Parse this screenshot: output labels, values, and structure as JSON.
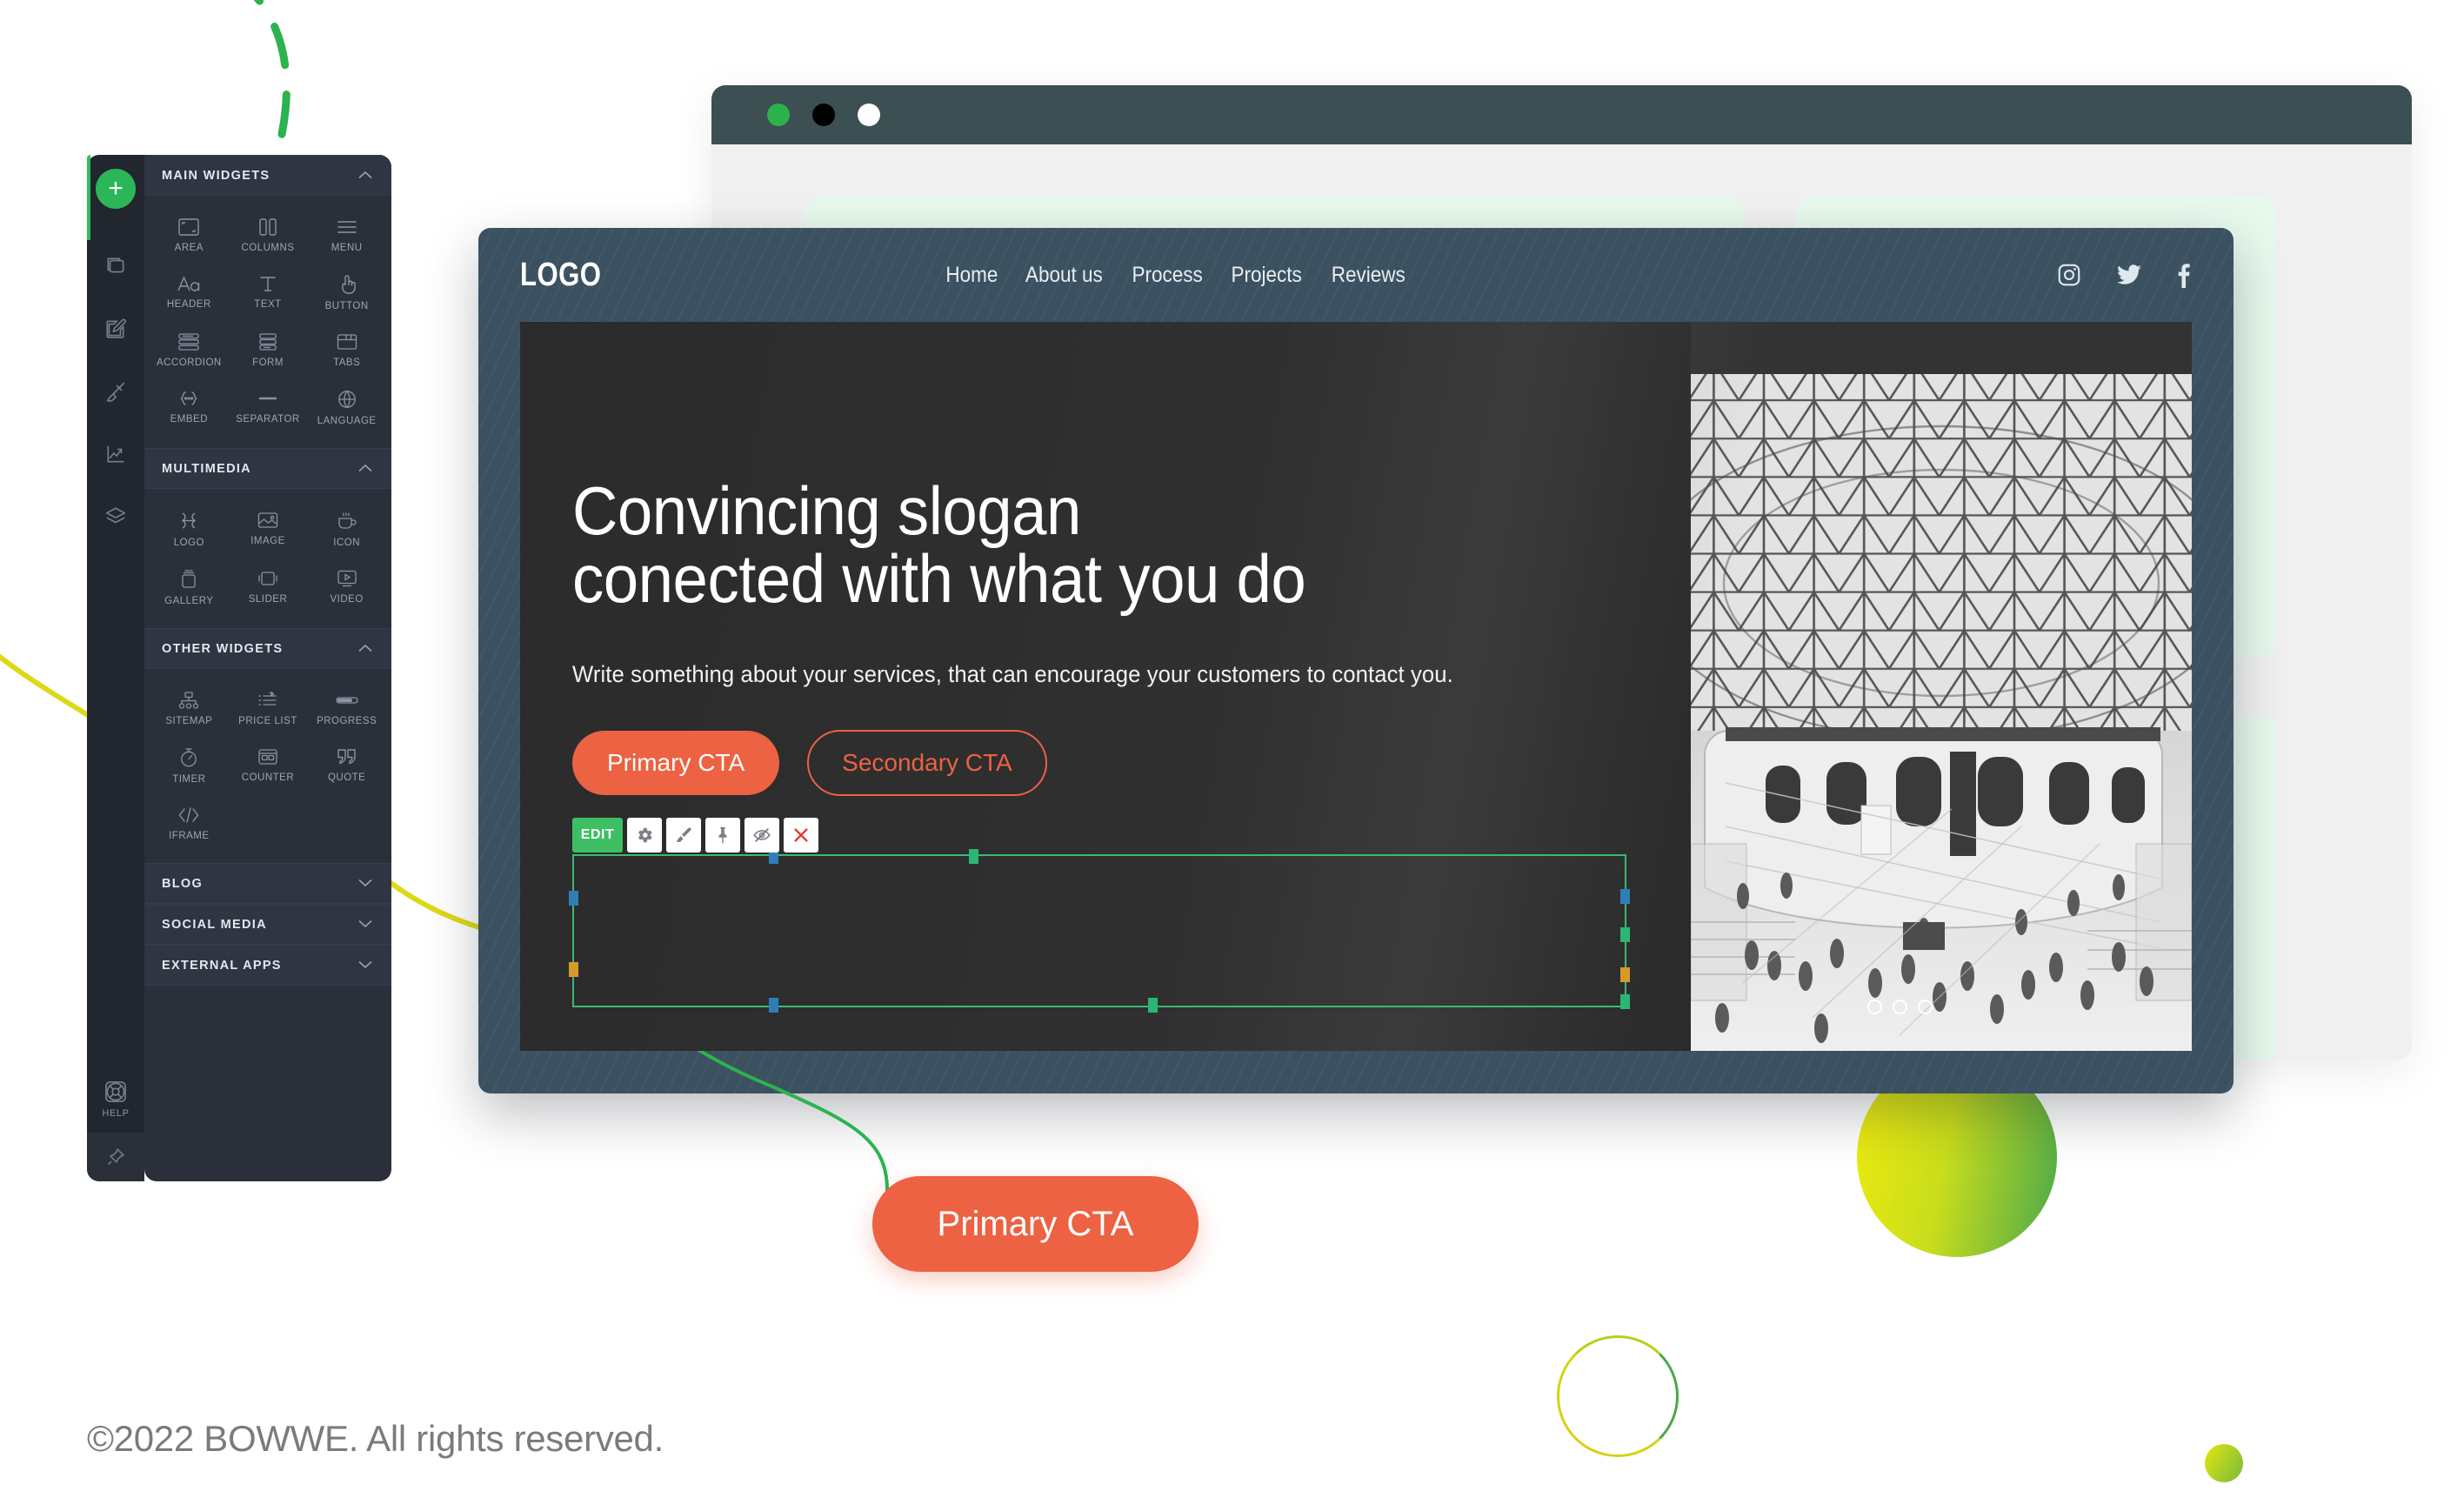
{
  "footer": {
    "copyright": "©2022 BOWWE. All rights reserved."
  },
  "rail": {
    "add_label": "+",
    "icons": [
      {
        "name": "pages-icon"
      },
      {
        "name": "edit-icon"
      },
      {
        "name": "brush-icon"
      },
      {
        "name": "analytics-icon"
      },
      {
        "name": "layers-icon"
      }
    ],
    "help_label": "HELP",
    "pin_label": "pin-icon"
  },
  "widget_panel": {
    "groups": [
      {
        "title": "MAIN WIDGETS",
        "expanded": true,
        "chevron": "chevron-up",
        "items": [
          {
            "label": "AREA",
            "icon": "area-icon"
          },
          {
            "label": "COLUMNS",
            "icon": "columns-icon"
          },
          {
            "label": "MENU",
            "icon": "menu-icon"
          },
          {
            "label": "HEADER",
            "icon": "header-icon"
          },
          {
            "label": "TEXT",
            "icon": "text-icon"
          },
          {
            "label": "BUTTON",
            "icon": "button-icon"
          },
          {
            "label": "ACCORDION",
            "icon": "accordion-icon"
          },
          {
            "label": "FORM",
            "icon": "form-icon"
          },
          {
            "label": "TABS",
            "icon": "tabs-icon"
          },
          {
            "label": "EMBED",
            "icon": "embed-icon"
          },
          {
            "label": "SEPARATOR",
            "icon": "separator-icon"
          },
          {
            "label": "LANGUAGE",
            "icon": "language-icon"
          }
        ]
      },
      {
        "title": "MULTIMEDIA",
        "expanded": true,
        "chevron": "chevron-up",
        "items": [
          {
            "label": "LOGO",
            "icon": "logo-icon"
          },
          {
            "label": "IMAGE",
            "icon": "image-icon"
          },
          {
            "label": "ICON",
            "icon": "cup-icon"
          },
          {
            "label": "GALLERY",
            "icon": "gallery-icon"
          },
          {
            "label": "SLIDER",
            "icon": "slider-icon"
          },
          {
            "label": "VIDEO",
            "icon": "video-icon"
          }
        ]
      },
      {
        "title": "OTHER WIDGETS",
        "expanded": true,
        "chevron": "chevron-up",
        "items": [
          {
            "label": "SITEMAP",
            "icon": "sitemap-icon"
          },
          {
            "label": "PRICE LIST",
            "icon": "price-list-icon"
          },
          {
            "label": "PROGRESS",
            "icon": "progress-icon"
          },
          {
            "label": "TIMER",
            "icon": "timer-icon"
          },
          {
            "label": "COUNTER",
            "icon": "counter-icon"
          },
          {
            "label": "QUOTE",
            "icon": "quote-icon"
          },
          {
            "label": "IFRAME",
            "icon": "iframe-icon"
          }
        ]
      },
      {
        "title": "BLOG",
        "expanded": false,
        "chevron": "chevron-down",
        "items": []
      },
      {
        "title": "SOCIAL MEDIA",
        "expanded": false,
        "chevron": "chevron-down",
        "items": []
      },
      {
        "title": "EXTERNAL APPS",
        "expanded": false,
        "chevron": "chevron-down",
        "items": []
      }
    ]
  },
  "browser": {
    "dots": [
      "green",
      "black",
      "white"
    ]
  },
  "site": {
    "logo": "LOGO",
    "menu": [
      "Home",
      "About us",
      "Process",
      "Projects",
      "Reviews"
    ],
    "social": [
      "instagram-icon",
      "twitter-icon",
      "facebook-icon"
    ],
    "hero": {
      "slogan": "Convincing slogan\nconected with what you do",
      "subtitle": "Write something about your services, that can encourage your customers to contact you.",
      "primary_cta": "Primary CTA",
      "secondary_cta": "Secondary CTA",
      "slider_dots": 3
    },
    "edit_toolbar": {
      "edit_label": "EDIT",
      "buttons": [
        "settings-gear-icon",
        "brush-icon",
        "pin-icon",
        "eye-slash-icon",
        "close-x-icon"
      ]
    }
  },
  "callout": {
    "label": "Primary CTA"
  },
  "colors": {
    "accent_orange": "#ec6242",
    "accent_green": "#2bb757",
    "selection_green": "#3cb878",
    "panel_dark": "#2a2f3a",
    "rail_dark": "#22262e",
    "site_header": "#3b5160",
    "mint": "#e7f8ec"
  }
}
